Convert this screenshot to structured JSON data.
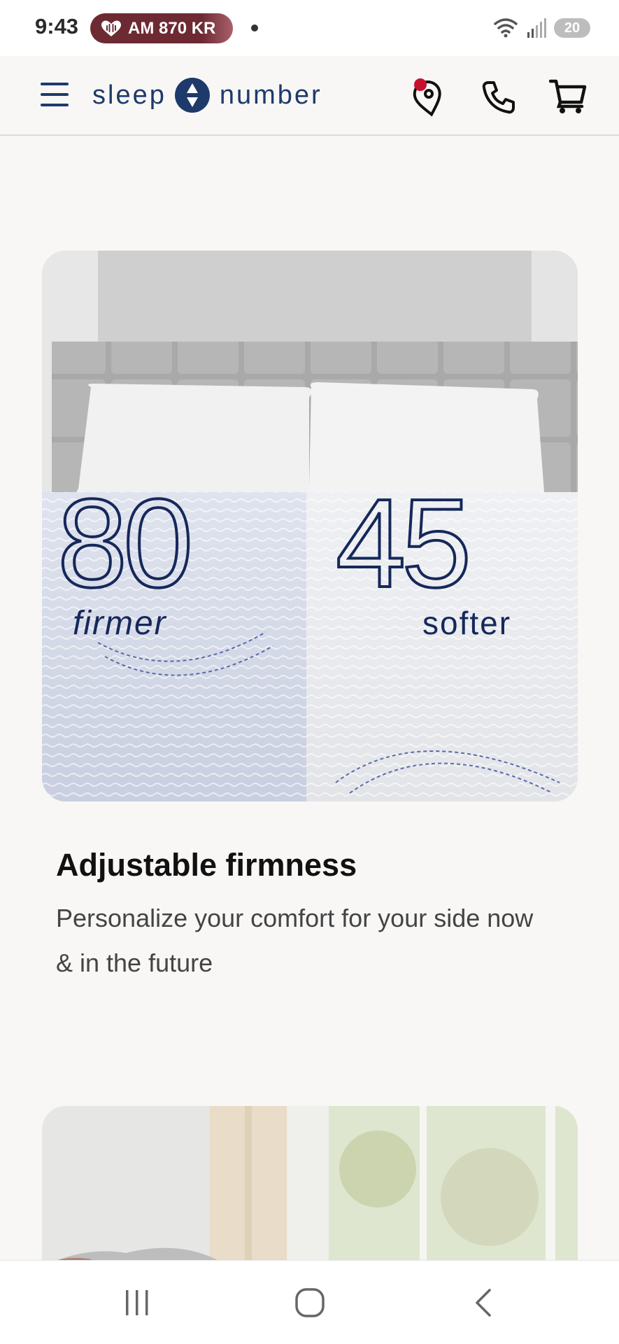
{
  "status_bar": {
    "time": "9:43",
    "radio_text": "AM 870 KR",
    "battery": "20"
  },
  "header": {
    "logo_left": "sleep",
    "logo_right": "number",
    "icons": [
      "menu-icon",
      "store-locator-icon",
      "phone-icon",
      "cart-icon"
    ],
    "notification_color": "#c8102e"
  },
  "feature_card": {
    "left_number": "80",
    "left_label": "firmer",
    "right_number": "45",
    "right_label": "softer",
    "title": "Adjustable firmness",
    "description": "Personalize your comfort for your side now & in the future"
  },
  "nav_bar": {
    "icons": [
      "recent-apps-icon",
      "home-icon",
      "back-icon"
    ]
  },
  "colors": {
    "brand": "#1e3a6b",
    "background": "#f8f7f6"
  }
}
